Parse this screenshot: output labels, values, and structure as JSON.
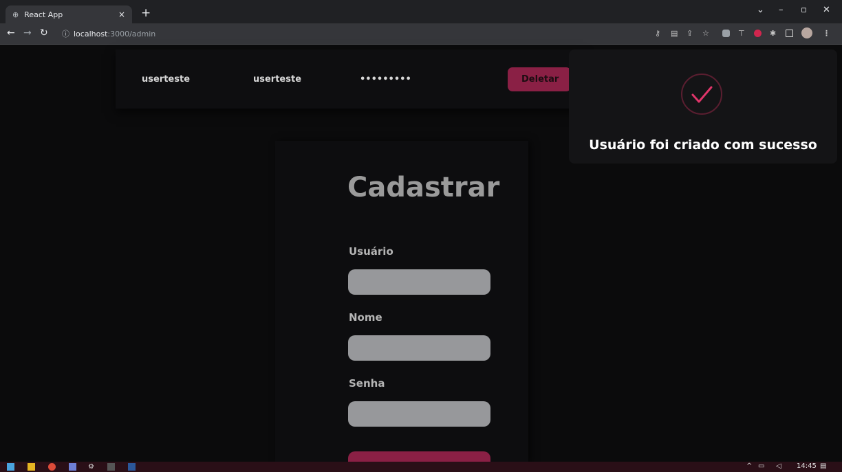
{
  "browser": {
    "tab_title": "React App",
    "tab_close": "×",
    "new_tab": "+",
    "address_host": "localhost",
    "address_path": ":3000/admin"
  },
  "user_row": {
    "username": "userteste",
    "name": "userteste",
    "password": "•••••••••",
    "delete_label": "Deletar"
  },
  "form": {
    "title": "Cadastrar",
    "fields": [
      {
        "label": "Usuário",
        "value": ""
      },
      {
        "label": "Nome",
        "value": ""
      },
      {
        "label": "Senha",
        "value": ""
      }
    ],
    "submit_label": ""
  },
  "toast": {
    "message": "Usuário foi criado com sucesso"
  },
  "taskbar": {
    "time": "14:45"
  },
  "colors": {
    "accent": "#8a2045",
    "check": "#e0356a",
    "background": "#0b0b0c"
  }
}
